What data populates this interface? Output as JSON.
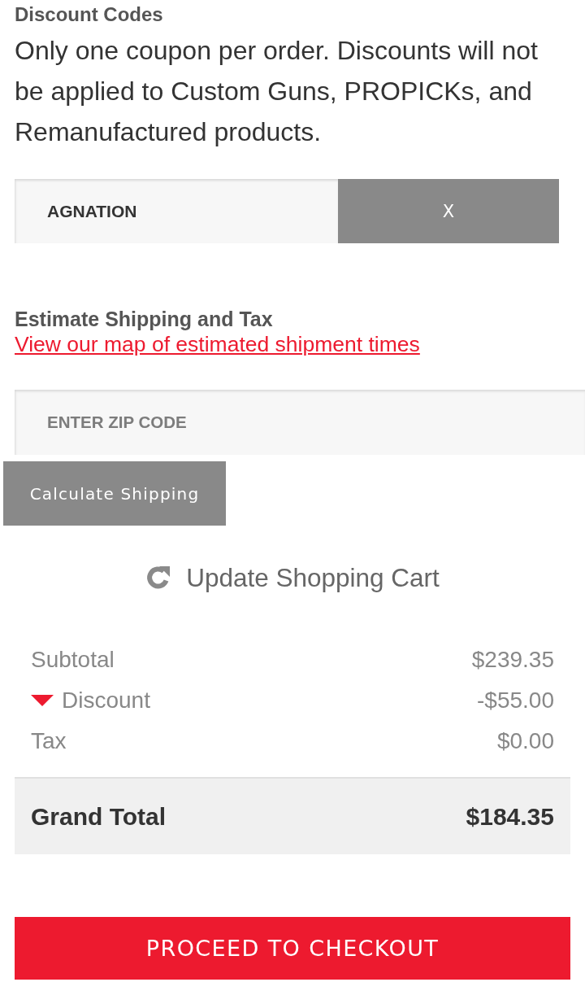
{
  "discount_codes": {
    "title": "Discount Codes",
    "note": "Only one coupon per order. Discounts will not be applied to Custom Guns, PROPICKs, and Remanufactured products.",
    "coupon": {
      "value": "AGNATION"
    },
    "remove_button": "X"
  },
  "shipping": {
    "title": "Estimate Shipping and Tax",
    "map_link": "View our map of estimated shipment times",
    "zip": {
      "placeholder": "ENTER ZIP CODE"
    },
    "calculate_button": "Calculate Shipping"
  },
  "update_cart": {
    "label": "Update Shopping Cart"
  },
  "totals": {
    "rows": [
      {
        "label": "Subtotal",
        "value": "$239.35",
        "kind": "plain"
      },
      {
        "label": "Discount",
        "value": "-$55.00",
        "kind": "toggle"
      },
      {
        "label": "Tax",
        "value": "$0.00",
        "kind": "plain"
      }
    ],
    "grand_total": {
      "label": "Grand Total",
      "value": "$184.35"
    }
  },
  "checkout_button": "PROCEED TO CHECKOUT"
}
